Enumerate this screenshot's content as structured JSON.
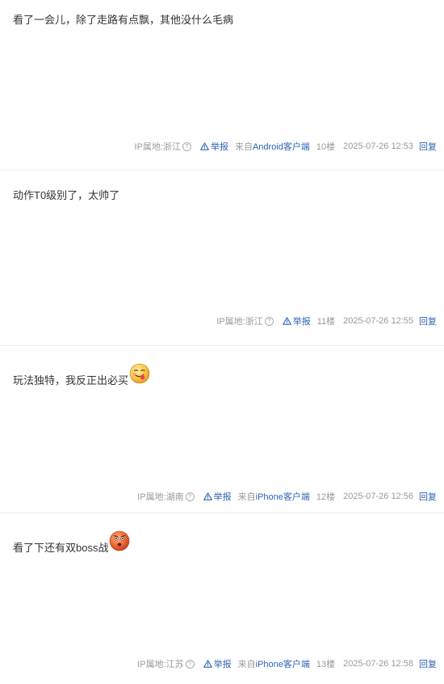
{
  "posts": [
    {
      "text": "看了一会儿，除了走路有点飘，其他没什么毛病",
      "emoji": null,
      "ip_label": "IP属地:浙江",
      "report_label": "举报",
      "client_prefix": "来自",
      "client_name": "Android客户端",
      "floor": "10楼",
      "time": "2025-07-26 12:53",
      "reply_label": "回复"
    },
    {
      "text": "动作T0级别了，太帅了",
      "emoji": null,
      "ip_label": "IP属地:浙江",
      "report_label": "举报",
      "client_prefix": null,
      "client_name": null,
      "floor": "11楼",
      "time": "2025-07-26 12:55",
      "reply_label": "回复"
    },
    {
      "text": "玩法独特，我反正出必买",
      "emoji": "tongue-out-emoji",
      "ip_label": "IP属地:湖南",
      "report_label": "举报",
      "client_prefix": "来自",
      "client_name": "iPhone客户端",
      "floor": "12楼",
      "time": "2025-07-26 12:56",
      "reply_label": "回复"
    },
    {
      "text": "看了下还有双boss战",
      "emoji": "surprised-emoji",
      "ip_label": "IP属地:江苏",
      "report_label": "举报",
      "client_prefix": "来自",
      "client_name": "iPhone客户端",
      "floor": "13楼",
      "time": "2025-07-26 12:58",
      "reply_label": "回复"
    }
  ],
  "colors": {
    "text": "#333333",
    "meta": "#999999",
    "link": "#2d64b3",
    "divider": "#ececec"
  }
}
